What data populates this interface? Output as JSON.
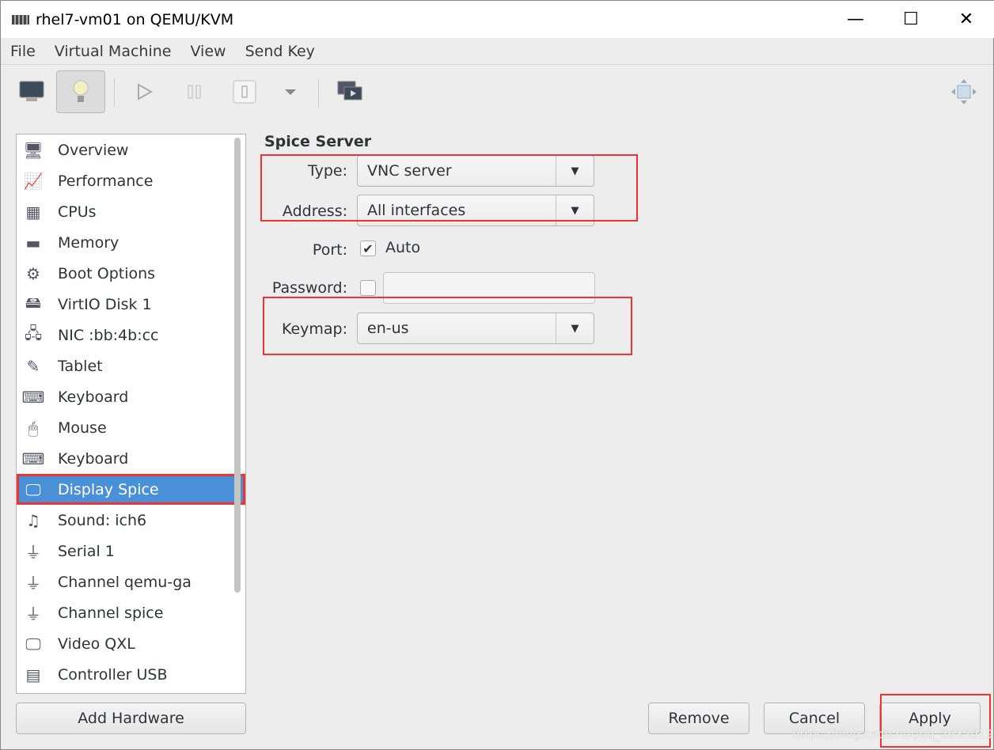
{
  "window": {
    "title": "rhel7-vm01 on QEMU/KVM",
    "minimize": "—",
    "maximize": "☐",
    "close": "✕"
  },
  "menu": [
    "File",
    "Virtual Machine",
    "View",
    "Send Key"
  ],
  "toolbar": {
    "icons": [
      "monitor-icon",
      "lightbulb-icon",
      "play-icon",
      "pause-icon",
      "power-icon",
      "dropdown-icon",
      "screenshot-icon",
      "fullscreen-icon"
    ]
  },
  "sidebar": {
    "items": [
      {
        "label": "Overview",
        "icon": "🖥"
      },
      {
        "label": "Performance",
        "icon": "📈"
      },
      {
        "label": "CPUs",
        "icon": "▦"
      },
      {
        "label": "Memory",
        "icon": "▬"
      },
      {
        "label": "Boot Options",
        "icon": "⚙"
      },
      {
        "label": "VirtIO Disk 1",
        "icon": "🖴"
      },
      {
        "label": "NIC :bb:4b:cc",
        "icon": "🖧"
      },
      {
        "label": "Tablet",
        "icon": "✎"
      },
      {
        "label": "Keyboard",
        "icon": "⌨"
      },
      {
        "label": "Mouse",
        "icon": "🖱"
      },
      {
        "label": "Keyboard",
        "icon": "⌨"
      },
      {
        "label": "Display Spice",
        "icon": "🖵"
      },
      {
        "label": "Sound: ich6",
        "icon": "♫"
      },
      {
        "label": "Serial 1",
        "icon": "⏚"
      },
      {
        "label": "Channel qemu-ga",
        "icon": "⏚"
      },
      {
        "label": "Channel spice",
        "icon": "⏚"
      },
      {
        "label": "Video QXL",
        "icon": "🖵"
      },
      {
        "label": "Controller USB",
        "icon": "▤"
      }
    ],
    "selected": "Display Spice",
    "add_hardware": "Add Hardware"
  },
  "main": {
    "heading": "Spice Server",
    "type_label": "Type:",
    "type_value": "VNC server",
    "address_label": "Address:",
    "address_value": "All interfaces",
    "port_label": "Port:",
    "port_auto": "Auto",
    "port_auto_checked": true,
    "password_label": "Password:",
    "password_checked": false,
    "password_value": "",
    "keymap_label": "Keymap:",
    "keymap_value": "en-us"
  },
  "buttons": {
    "remove": "Remove",
    "cancel": "Cancel",
    "apply": "Apply"
  },
  "watermark": "https://blog.csdn.net/qq_26350199",
  "colors": {
    "selection": "#4a90d9",
    "highlight": "#e33333"
  }
}
